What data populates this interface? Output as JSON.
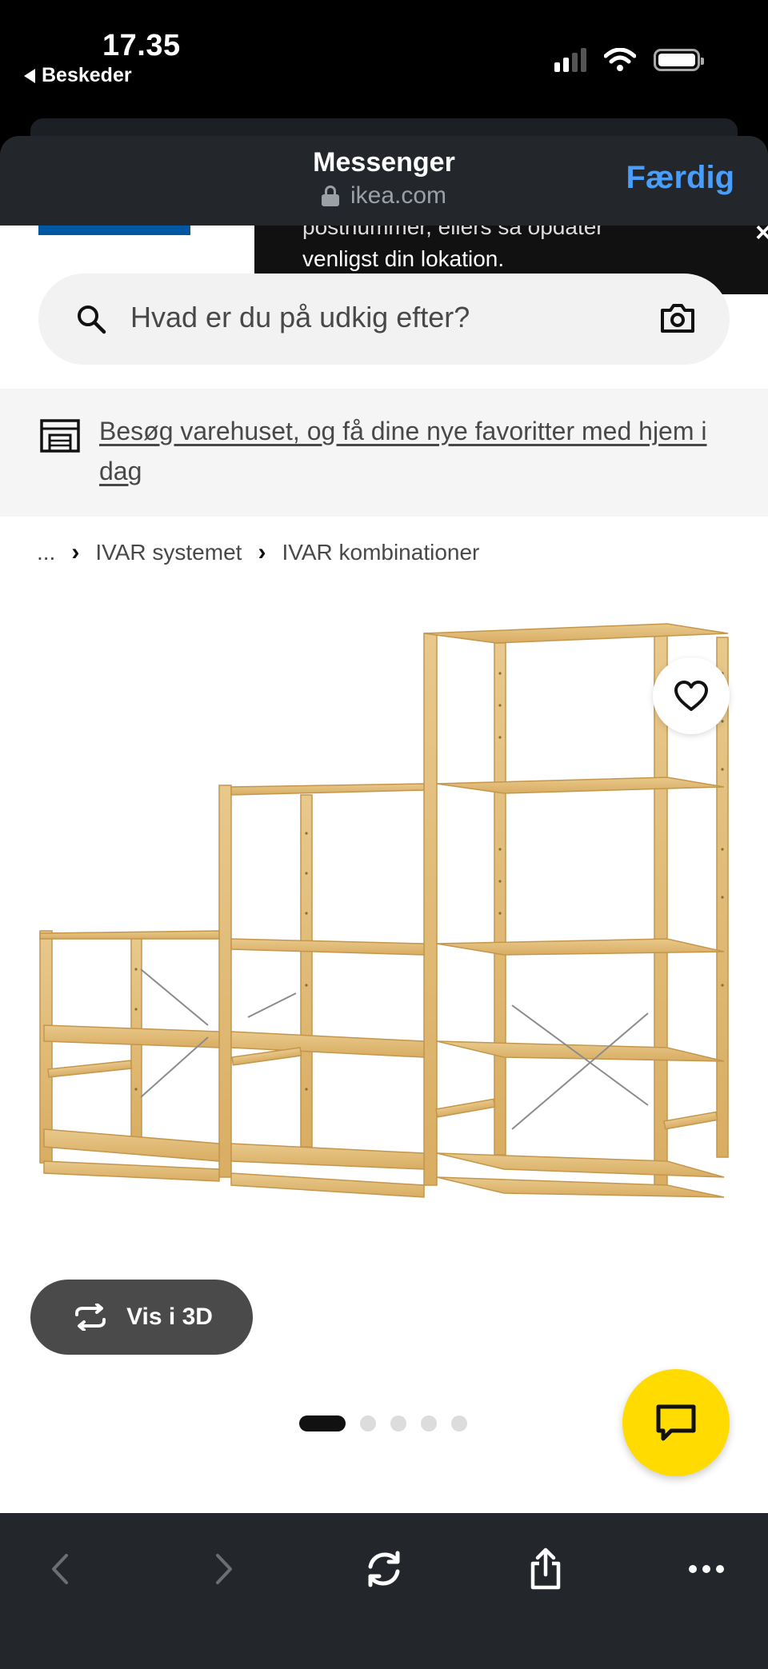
{
  "status_bar": {
    "time": "17.35",
    "back_label": "Beskeder"
  },
  "browser": {
    "title": "Messenger",
    "domain": "ikea.com",
    "done_label": "Færdig"
  },
  "toast": {
    "line1": "postnummer, ellers så opdater",
    "line2": "venligst din lokation.",
    "close": "×"
  },
  "search": {
    "placeholder": "Hvad er du på udkig efter?"
  },
  "store_banner": {
    "text": "Besøg varehuset, og få dine nye favoritter med hjem i dag"
  },
  "breadcrumb": {
    "ellipsis": "...",
    "items": [
      "IVAR systemet",
      "IVAR kombinationer"
    ]
  },
  "gallery": {
    "view3d_label": "Vis i 3D",
    "total_images": 5,
    "active_index": 0
  },
  "colors": {
    "ikea_blue": "#0058a3",
    "ikea_yellow": "#ffdb00",
    "link_blue": "#4a9df8",
    "toolbar_bg": "#23272b"
  }
}
